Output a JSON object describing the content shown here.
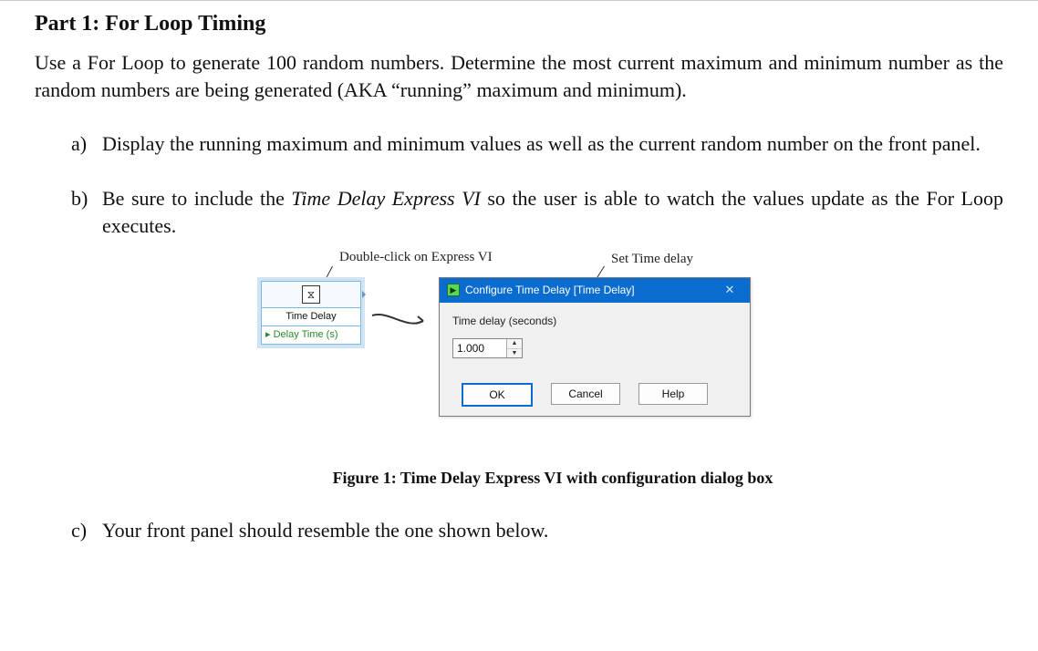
{
  "heading": "Part 1: For Loop Timing",
  "intro": "Use a For Loop to generate 100 random numbers. Determine the most current maximum and minimum number as the random numbers are being generated (AKA “running” maximum and minimum).",
  "items": {
    "a": {
      "marker": "a)",
      "text": "Display the running maximum and minimum values as well as the current random number on the front panel."
    },
    "b": {
      "marker": "b)",
      "pre": "Be sure to include the ",
      "ital": "Time Delay Express VI",
      "post": " so the user is able to watch the values update as the For Loop executes."
    },
    "c": {
      "marker": "c)",
      "text": "Your front panel should resemble the one shown below."
    }
  },
  "figure": {
    "annot_doubleclick": "Double-click on Express VI",
    "annot_setdelay": "Set Time delay",
    "vi": {
      "icon_glyph": "⧖",
      "name": "Time Delay",
      "param": "Delay Time (s)",
      "param_marker": "▸"
    },
    "dialog": {
      "title": "Configure Time Delay [Time Delay]",
      "title_icon_glyph": "▶",
      "close_glyph": "✕",
      "field_label": "Time delay (seconds)",
      "value": "1.000",
      "spin_up": "▲",
      "spin_down": "▼",
      "ok": "OK",
      "cancel": "Cancel",
      "help": "Help"
    },
    "caption_bold": "Figure 1: Time Delay Express VI with configuration dialog box"
  }
}
